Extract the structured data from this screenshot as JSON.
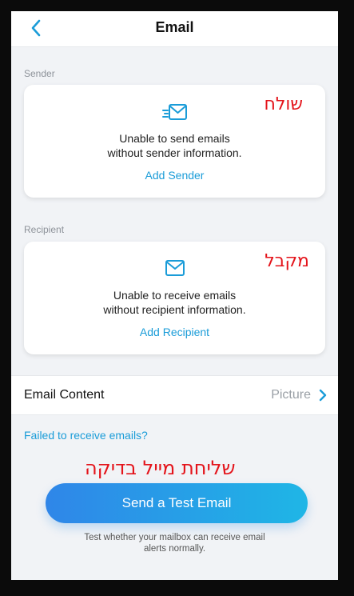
{
  "nav": {
    "title": "Email"
  },
  "sender": {
    "section_label": "Sender",
    "message_line1": "Unable to send emails",
    "message_line2": "without sender information.",
    "link": "Add Sender",
    "annotation": "שולח"
  },
  "recipient": {
    "section_label": "Recipient",
    "message_line1": "Unable to receive emails",
    "message_line2": "without recipient information.",
    "link": "Add Recipient",
    "annotation": "מקבל"
  },
  "email_content": {
    "label": "Email Content",
    "value": "Picture"
  },
  "failed_link": "Failed to receive emails?",
  "test_annotation": "שליחת מייל בדיקה",
  "send_button": "Send a Test Email",
  "hint_line1": "Test whether your mailbox can receive email",
  "hint_line2": "alerts normally.",
  "colors": {
    "accent": "#1a9cd8",
    "annotation": "#e4141b",
    "button_start": "#2f86e8",
    "button_end": "#1fb6e6"
  },
  "icons": {
    "back": "chevron-left-icon",
    "sender": "send-email-icon",
    "recipient": "envelope-icon",
    "row": "chevron-right-icon"
  }
}
